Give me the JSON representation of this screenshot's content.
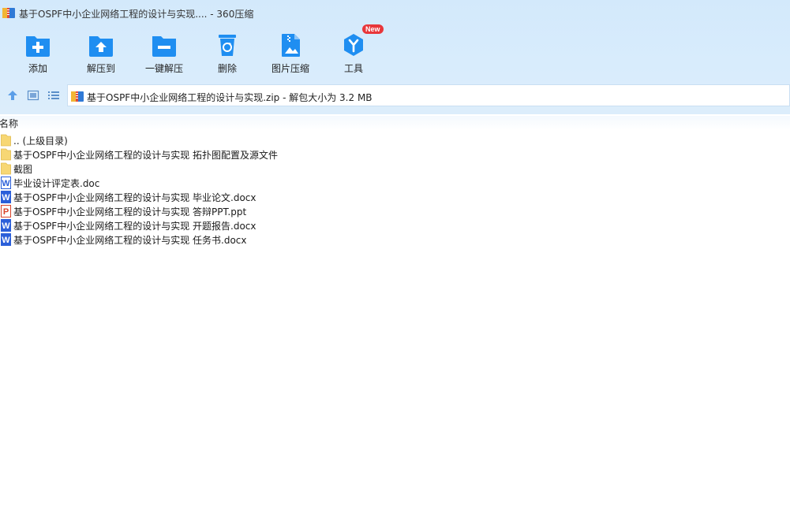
{
  "window": {
    "title": "基于OSPF中小企业网络工程的设计与实现.... - 360压缩"
  },
  "toolbar": {
    "items": [
      {
        "label": "添加",
        "icon": "add-folder-icon"
      },
      {
        "label": "解压到",
        "icon": "extract-to-icon"
      },
      {
        "label": "一键解压",
        "icon": "one-click-extract-icon"
      },
      {
        "label": "删除",
        "icon": "recycle-bin-icon"
      },
      {
        "label": "图片压缩",
        "icon": "image-compress-icon"
      },
      {
        "label": "工具",
        "icon": "tools-icon",
        "badge": "New"
      }
    ]
  },
  "address": {
    "text": "基于OSPF中小企业网络工程的设计与实现.zip - 解包大小为 3.2 MB"
  },
  "columns": {
    "name": "名称"
  },
  "files": [
    {
      "name": ".. (上级目录)",
      "type": "folder"
    },
    {
      "name": "基于OSPF中小企业网络工程的设计与实现 拓扑图配置及源文件",
      "type": "folder"
    },
    {
      "name": "截图",
      "type": "folder"
    },
    {
      "name": "毕业设计评定表.doc",
      "type": "word"
    },
    {
      "name": "基于OSPF中小企业网络工程的设计与实现 毕业论文.docx",
      "type": "word"
    },
    {
      "name": "基于OSPF中小企业网络工程的设计与实现 答辩PPT.ppt",
      "type": "ppt"
    },
    {
      "name": "基于OSPF中小企业网络工程的设计与实现 开题报告.docx",
      "type": "word"
    },
    {
      "name": "基于OSPF中小企业网络工程的设计与实现 任务书.docx",
      "type": "word"
    }
  ],
  "colors": {
    "accent": "#1f8ef1",
    "header_bg": "#d6eafc",
    "folder": "#f7d774",
    "word": "#2b5fd9",
    "ppt": "#d9452b",
    "badge": "#e8363a"
  }
}
